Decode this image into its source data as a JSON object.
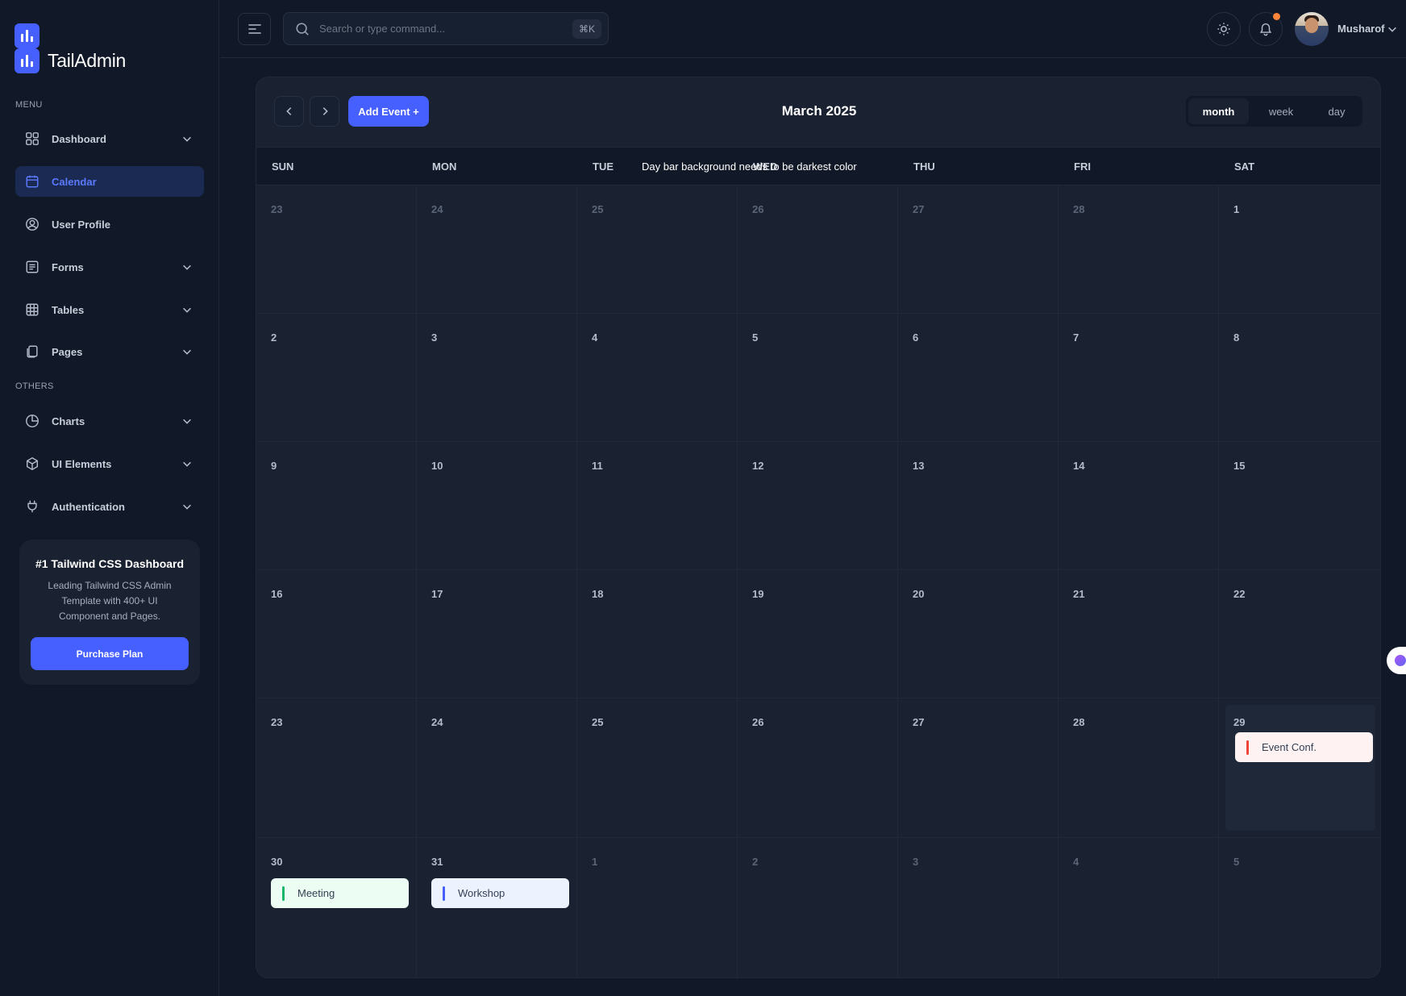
{
  "brand": {
    "name": "TailAdmin"
  },
  "sidebar": {
    "menu_label": "MENU",
    "others_label": "OTHERS",
    "items": [
      {
        "label": "Dashboard",
        "icon": "grid-icon",
        "has_chevron": true
      },
      {
        "label": "Calendar",
        "icon": "calendar-icon",
        "active": true
      },
      {
        "label": "User Profile",
        "icon": "user-circle-icon"
      },
      {
        "label": "Forms",
        "icon": "list-icon",
        "has_chevron": true
      },
      {
        "label": "Tables",
        "icon": "table-icon",
        "has_chevron": true
      },
      {
        "label": "Pages",
        "icon": "pages-icon",
        "has_chevron": true
      }
    ],
    "other_items": [
      {
        "label": "Charts",
        "icon": "pie-chart-icon",
        "has_chevron": true
      },
      {
        "label": "UI Elements",
        "icon": "box-icon",
        "has_chevron": true
      },
      {
        "label": "Authentication",
        "icon": "plug-icon",
        "has_chevron": true
      }
    ],
    "promo": {
      "title": "#1 Tailwind CSS Dashboard",
      "description": "Leading Tailwind CSS Admin Template with 400+ UI Component and Pages.",
      "button": "Purchase Plan"
    }
  },
  "header": {
    "search": {
      "placeholder": "Search or type command...",
      "shortcut": "⌘K"
    },
    "user": {
      "name": "Musharof"
    }
  },
  "calendar": {
    "title": "March 2025",
    "add_event": "Add Event +",
    "views": [
      "month",
      "week",
      "day"
    ],
    "active_view": "month",
    "day_names": [
      "SUN",
      "MON",
      "TUE",
      "WED",
      "THU",
      "FRI",
      "SAT"
    ],
    "annotation": "Day bar background needs to be darkest color",
    "weeks": [
      [
        {
          "d": "23",
          "m": true
        },
        {
          "d": "24",
          "m": true
        },
        {
          "d": "25",
          "m": true
        },
        {
          "d": "26",
          "m": true
        },
        {
          "d": "27",
          "m": true
        },
        {
          "d": "28",
          "m": true
        },
        {
          "d": "1"
        }
      ],
      [
        {
          "d": "2"
        },
        {
          "d": "3"
        },
        {
          "d": "4"
        },
        {
          "d": "5"
        },
        {
          "d": "6"
        },
        {
          "d": "7"
        },
        {
          "d": "8"
        }
      ],
      [
        {
          "d": "9"
        },
        {
          "d": "10"
        },
        {
          "d": "11"
        },
        {
          "d": "12"
        },
        {
          "d": "13"
        },
        {
          "d": "14"
        },
        {
          "d": "15"
        }
      ],
      [
        {
          "d": "16"
        },
        {
          "d": "17"
        },
        {
          "d": "18"
        },
        {
          "d": "19"
        },
        {
          "d": "20"
        },
        {
          "d": "21"
        },
        {
          "d": "22"
        }
      ],
      [
        {
          "d": "23"
        },
        {
          "d": "24"
        },
        {
          "d": "25"
        },
        {
          "d": "26"
        },
        {
          "d": "27"
        },
        {
          "d": "28"
        },
        {
          "d": "29",
          "hl": true,
          "event": {
            "title": "Event Conf.",
            "color": "red"
          }
        }
      ],
      [
        {
          "d": "30",
          "event": {
            "title": "Meeting",
            "color": "green"
          }
        },
        {
          "d": "31",
          "event": {
            "title": "Workshop",
            "color": "blue"
          }
        },
        {
          "d": "1",
          "m": true
        },
        {
          "d": "2",
          "m": true
        },
        {
          "d": "3",
          "m": true
        },
        {
          "d": "4",
          "m": true
        },
        {
          "d": "5",
          "m": true
        }
      ]
    ]
  },
  "colors": {
    "accent": "#465fff",
    "background": "#111827",
    "card": "#1a2231",
    "event_red": "#f04438",
    "event_green": "#12b76a",
    "event_blue": "#465fff",
    "notification": "#fd853a"
  }
}
